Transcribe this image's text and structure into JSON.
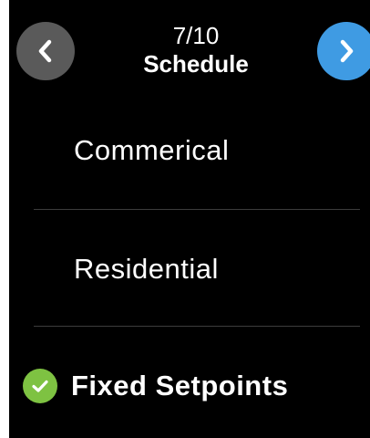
{
  "header": {
    "step": "7/10",
    "title": "Schedule"
  },
  "nav": {
    "back_icon": "chevron-left-icon",
    "next_icon": "chevron-right-icon"
  },
  "options": [
    {
      "label": "Commerical",
      "selected": false
    },
    {
      "label": "Residential",
      "selected": false
    },
    {
      "label": "Fixed Setpoints",
      "selected": true
    }
  ],
  "colors": {
    "back_button": "#5a5a5a",
    "next_button": "#3f9be3",
    "selected_check": "#7ec242",
    "background": "#000000"
  }
}
